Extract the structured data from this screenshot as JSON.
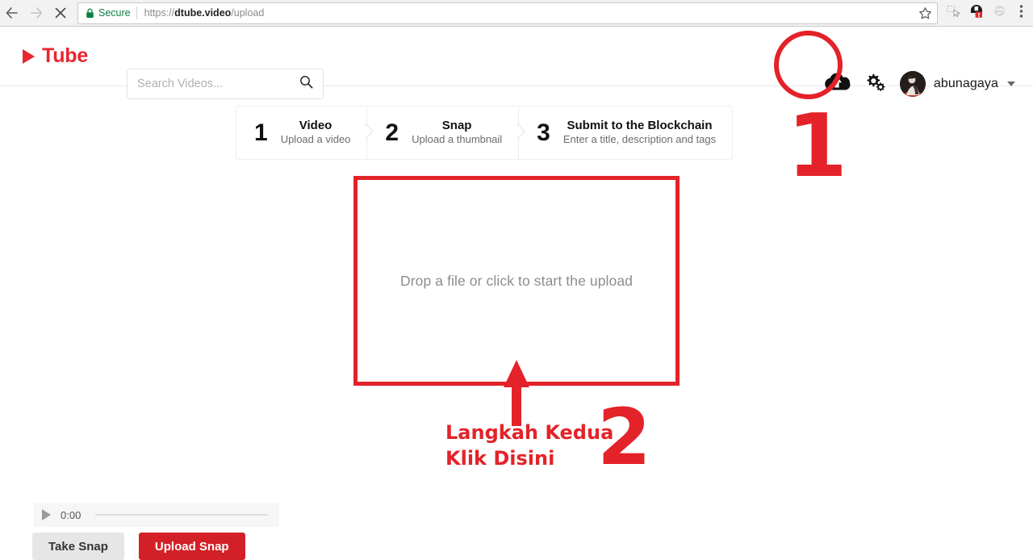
{
  "browser": {
    "back_icon": "arrow-left-icon",
    "forward_icon": "arrow-right-icon",
    "stop_icon": "close-icon",
    "security_label": "Secure",
    "url_prefix": "https://",
    "url_domain": "dtube.video",
    "url_path": "/upload",
    "url_full": "https://dtube.video/upload",
    "bookmark_icon": "star-icon",
    "extension_1_icon": "cursor-extension-icon",
    "extension_2_icon": "adblock-extension-icon",
    "extension_2_badge": "1",
    "extension_3_icon": "globe-extension-icon",
    "menu_icon": "kebab-menu-icon"
  },
  "header": {
    "logo_icon": "play-triangle-icon",
    "logo_text": "Tube",
    "search": {
      "placeholder": "Search Videos...",
      "value": "",
      "icon": "search-icon"
    },
    "upload_icon": "cloud-upload-icon",
    "settings_icon": "gears-icon",
    "avatar_icon": "avatar",
    "username": "abunagaya",
    "caret_icon": "chevron-down-icon"
  },
  "stepper": {
    "steps": [
      {
        "num": "1",
        "title": "Video",
        "sub": "Upload a video"
      },
      {
        "num": "2",
        "title": "Snap",
        "sub": "Upload a thumbnail"
      },
      {
        "num": "3",
        "title": "Submit to the Blockchain",
        "sub": "Enter a title, description and tags"
      }
    ]
  },
  "dropzone": {
    "text": "Drop a file or click to start the upload"
  },
  "annotations": {
    "accent_color": "#e42229",
    "circle_target": "upload-icon",
    "step1_number": "1",
    "step2_number": "2",
    "arrow_icon": "arrow-up-icon",
    "label_line1": "Langkah Kedua",
    "label_line2": "Klik Disini"
  },
  "player": {
    "play_icon": "play-icon",
    "time": "0:00"
  },
  "buttons": {
    "take_snap": "Take Snap",
    "upload_snap": "Upload Snap"
  }
}
